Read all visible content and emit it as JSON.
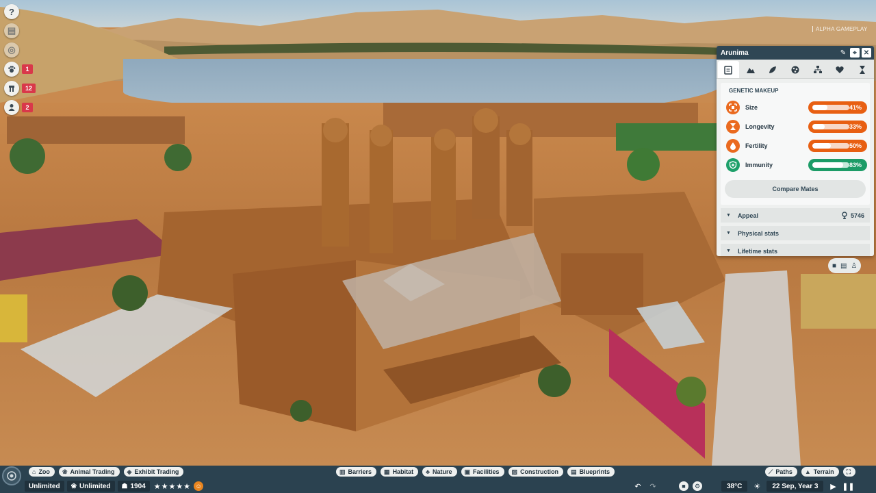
{
  "hud": {
    "alpha_label": "ALPHA GAMEPLAY",
    "left_buttons": [
      {
        "icon": "help-icon",
        "glyph": "?"
      },
      {
        "icon": "notes-icon",
        "glyph": "▤"
      },
      {
        "icon": "globe-icon",
        "glyph": "◎"
      }
    ],
    "counters": [
      {
        "icon": "paw-icon",
        "value": "1"
      },
      {
        "icon": "staff-icon",
        "value": "12"
      },
      {
        "icon": "guest-icon",
        "value": "2"
      }
    ]
  },
  "panel": {
    "title": "Arunima",
    "genetic_title": "GENETIC MAKEUP",
    "stats": [
      {
        "label": "Size",
        "value": "41%",
        "fraction": 0.41,
        "color": "#e85f12"
      },
      {
        "label": "Longevity",
        "value": "33%",
        "fraction": 0.33,
        "color": "#e85f12"
      },
      {
        "label": "Fertility",
        "value": "50%",
        "fraction": 0.5,
        "color": "#e85f12"
      },
      {
        "label": "Immunity",
        "value": "83%",
        "fraction": 0.83,
        "color": "#1c9c67"
      }
    ],
    "compare_label": "Compare Mates",
    "appeal_label": "Appeal",
    "appeal_value": "5746",
    "physical_label": "Physical stats",
    "lifetime_label": "Lifetime stats"
  },
  "toolbar": {
    "left": [
      {
        "label": "Zoo",
        "icon": "zoo-icon"
      },
      {
        "label": "Animal Trading",
        "icon": "paw-icon"
      },
      {
        "label": "Exhibit Trading",
        "icon": "exhibit-icon"
      }
    ],
    "center": [
      {
        "label": "Barriers",
        "icon": "barrier-icon"
      },
      {
        "label": "Habitat",
        "icon": "habitat-icon"
      },
      {
        "label": "Nature",
        "icon": "tree-icon"
      },
      {
        "label": "Facilities",
        "icon": "facilities-icon"
      },
      {
        "label": "Construction",
        "icon": "construction-icon"
      },
      {
        "label": "Blueprints",
        "icon": "blueprint-icon"
      }
    ],
    "right": [
      {
        "label": "Paths",
        "icon": "paths-icon"
      },
      {
        "label": "Terrain",
        "icon": "terrain-icon"
      }
    ]
  },
  "status": {
    "money": "Unlimited",
    "conservation": "Unlimited",
    "guests": "1904",
    "stars": "★★★★★",
    "temperature": "38°C",
    "date": "22 Sep, Year 3"
  },
  "colors": {
    "bar_dark": "#2b4250",
    "accent_orange": "#e85f12",
    "accent_green": "#1c9c67",
    "counter_red": "#d9384a"
  }
}
